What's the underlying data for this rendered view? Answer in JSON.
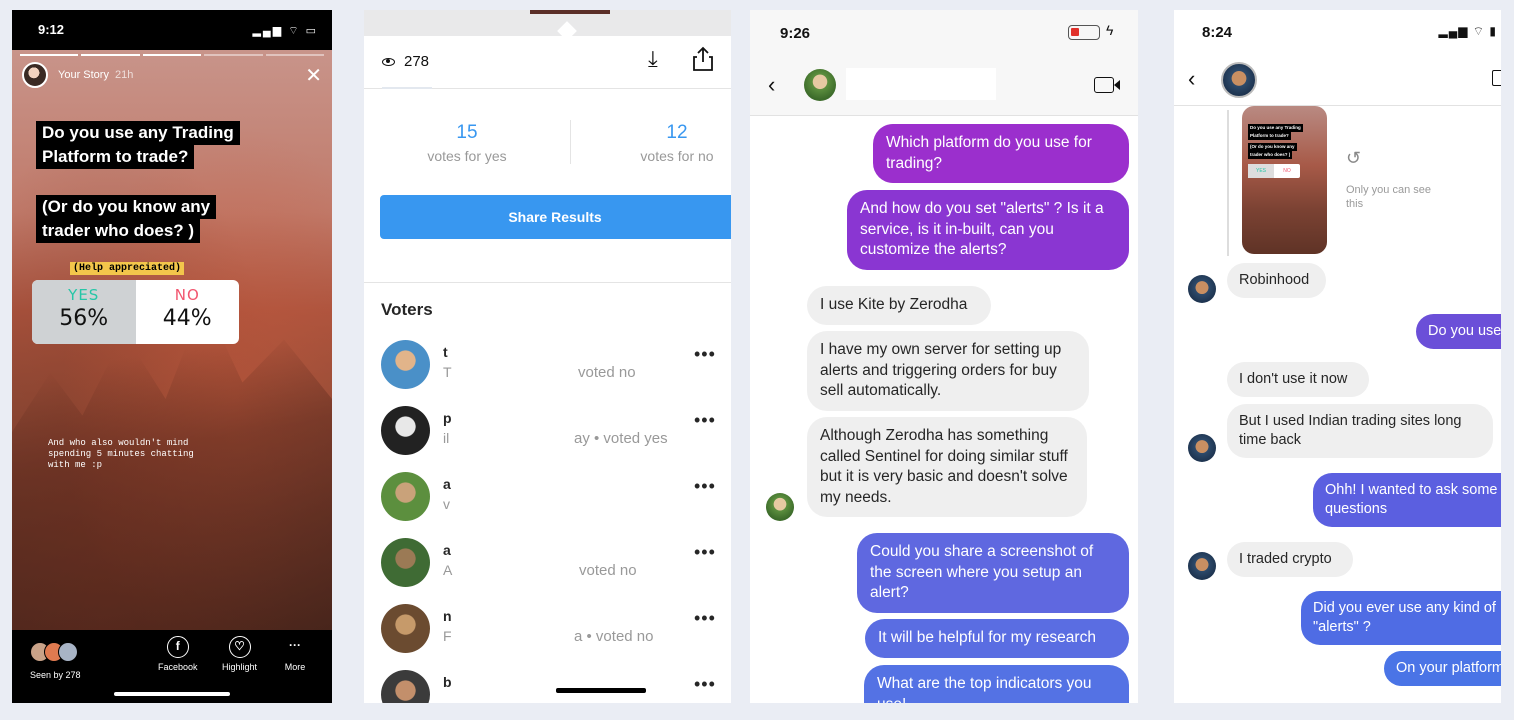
{
  "story": {
    "time": "9:12",
    "status_icons": "▂▄▆ ⌔ ▭",
    "owner": "Your Story",
    "age": "21h",
    "question_lines": [
      "Do you use any Trading",
      "Platform to trade?"
    ],
    "sub_question_lines": [
      "(Or do you know any",
      "trader who does? )"
    ],
    "help_note": "(Help appreciated)",
    "poll": {
      "yes_label": "YES",
      "yes_pct": "56%",
      "no_label": "NO",
      "no_pct": "44%"
    },
    "footer_note": "And who also wouldn't mind spending 5 minutes chatting with me :p",
    "seen_by": "Seen by 278",
    "actions": [
      {
        "label": "Facebook",
        "icon": "f"
      },
      {
        "label": "Highlight",
        "icon": "♡"
      },
      {
        "label": "More",
        "icon": "···"
      }
    ],
    "close_icon": "✕"
  },
  "insights": {
    "views": "278",
    "yes_count": "15",
    "yes_label": "votes for yes",
    "no_count": "12",
    "no_label": "votes for no",
    "share_button": "Share Results",
    "voters_title": "Voters",
    "voters": [
      {
        "init": "t",
        "sub": "T",
        "vote": "voted no",
        "colors": [
          "#4a90c8",
          "#e2b48a"
        ]
      },
      {
        "init": "p",
        "sub": "il",
        "vote": "ay • voted yes",
        "colors": [
          "#222",
          "#e8e8e8"
        ]
      },
      {
        "init": "a",
        "sub": "v",
        "vote": "",
        "colors": [
          "#5c8f3e",
          "#c9a27a"
        ]
      },
      {
        "init": "a",
        "sub": "A",
        "vote": "voted no",
        "colors": [
          "#3f6b34",
          "#9b7a55"
        ]
      },
      {
        "init": "n",
        "sub": "F",
        "vote": "a • voted no",
        "colors": [
          "#6b4b30",
          "#c69a6a"
        ]
      },
      {
        "init": "b",
        "sub": "",
        "vote": "",
        "colors": [
          "#3b3b3b",
          "#c38f6b"
        ]
      }
    ],
    "more_icon": "•••",
    "download_icon": "⤓"
  },
  "chat1": {
    "time": "9:26",
    "bolt": "ϟ",
    "back_icon": "‹",
    "messages": [
      {
        "side": "out",
        "text": "Which platform do you use for trading?",
        "color": "#9b2fcd"
      },
      {
        "side": "out",
        "text": "And how do you set \"alerts\" ? Is it a service, is it in-built, can you customize the alerts?",
        "color": "#8a36d2"
      },
      {
        "side": "in",
        "text": "I use Kite by Zerodha"
      },
      {
        "side": "in",
        "text": "I have my own server for setting up alerts and triggering orders for buy sell automatically."
      },
      {
        "side": "in",
        "text": "Although Zerodha has something called Sentinel for doing similar stuff but it is very basic and doesn't solve my needs."
      },
      {
        "side": "out",
        "text": "Could you share a screenshot of the screen where you setup an alert?",
        "color": "#5f68e0"
      },
      {
        "side": "out",
        "text": "It will be helpful for my research",
        "color": "#5a6de2"
      },
      {
        "side": "out",
        "text": "What are the top indicators you use!",
        "color": "#5472e4"
      }
    ]
  },
  "chat2": {
    "time": "8:24",
    "status_icons": "▂▄▆ ⌔ ▮",
    "back_icon": "‹",
    "history_icon": "↺",
    "only_you": "Only you can see this",
    "thumb": {
      "lines": [
        "Do you use any Trading",
        "Platform to trade?",
        "(Or do you know any",
        "trader who does? )"
      ],
      "yes": "YES",
      "no": "NO"
    },
    "messages": [
      {
        "side": "in",
        "text": "Robinhood"
      },
      {
        "side": "out",
        "text": "Do you use",
        "color": "#6b4fd8"
      },
      {
        "side": "in",
        "text": "I don't use it now"
      },
      {
        "side": "in",
        "text": "But I used Indian trading sites long time back"
      },
      {
        "side": "out",
        "text": "Ohh! I wanted to ask some questions",
        "color": "#5b5fe0"
      },
      {
        "side": "in",
        "text": "I traded crypto"
      },
      {
        "side": "out",
        "text": "Did you ever use any kind of \"alerts\" ?",
        "color": "#4f6ce4"
      },
      {
        "side": "out",
        "text": "On your platform",
        "color": "#4a74e6"
      }
    ]
  }
}
